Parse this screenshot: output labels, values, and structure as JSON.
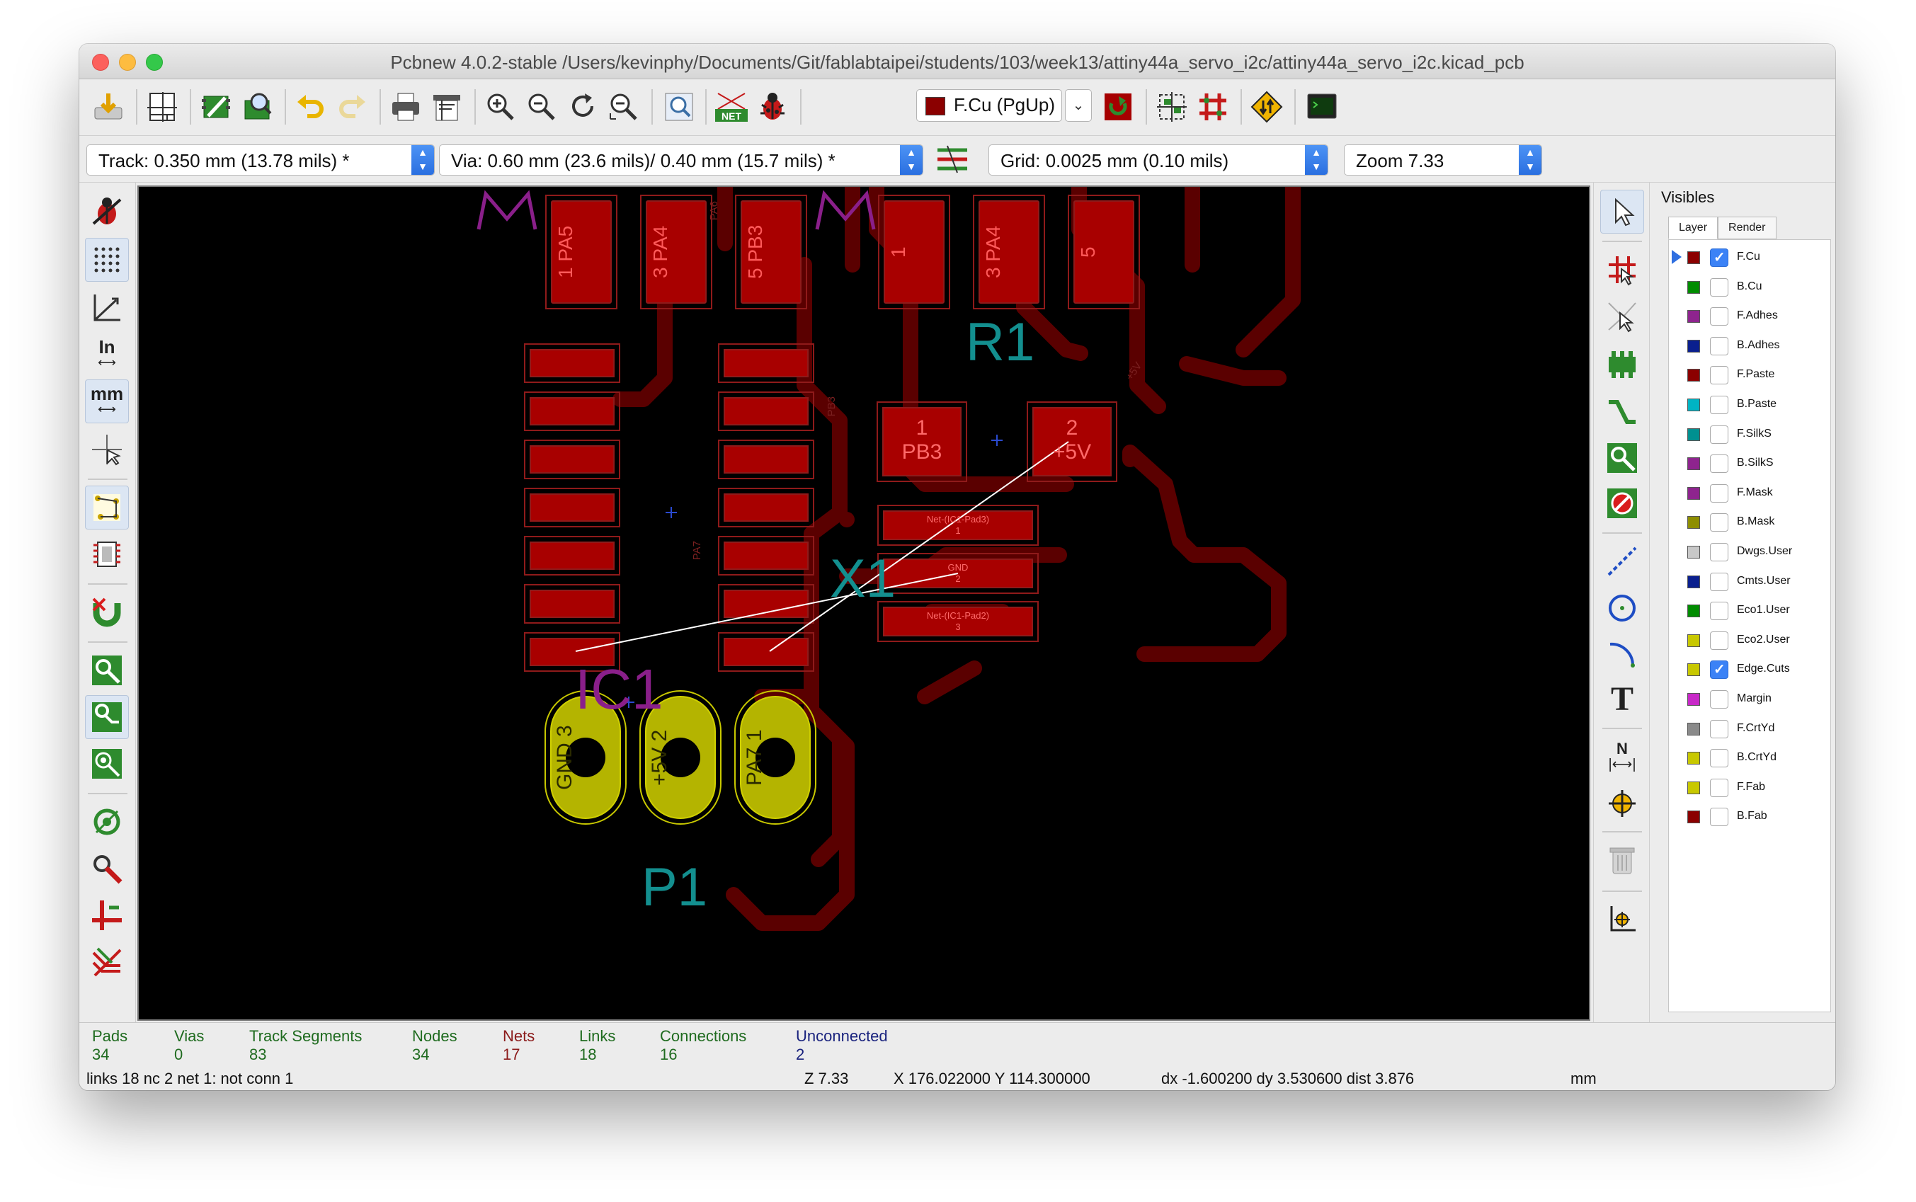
{
  "window": {
    "title": "Pcbnew 4.0.2-stable /Users/kevinphy/Documents/Git/fablabtaipei/students/103/week13/attiny44a_servo_i2c/attiny44a_servo_i2c.kicad_pcb"
  },
  "toolbar": {
    "layer_selector": "F.Cu (PgUp)",
    "icons": [
      "save-icon",
      "page-settings-icon",
      "library-editor-icon",
      "library-browser-icon",
      "undo-icon",
      "redo-icon",
      "print-icon",
      "plot-icon",
      "zoom-in-icon",
      "zoom-out-icon",
      "redraw-icon",
      "zoom-fit-icon",
      "find-icon",
      "netlist-icon",
      "drc-icon",
      "layer-select-icon",
      "layer-pair-icon",
      "autoplace-icon",
      "autoroute-icon",
      "microwave-icon",
      "scripting-console-icon"
    ]
  },
  "aux_toolbar": {
    "track": "Track: 0.350 mm (13.78 mils) *",
    "via": "Via: 0.60 mm (23.6 mils)/ 0.40 mm (15.7 mils) *",
    "grid": "Grid: 0.0025 mm (0.10 mils)",
    "zoom": "Zoom 7.33"
  },
  "left_toolbar": {
    "in_label": "In",
    "mm_label": "mm",
    "icons": [
      "drc-off-icon",
      "grid-toggle-icon",
      "polar-coords-icon",
      "inch-units-icon",
      "mm-units-icon",
      "cursor-shape-icon",
      "ratsnest-icon",
      "module-ratsnest-icon",
      "magnetic-icon",
      "zone-fill-icon",
      "track-sketch-icon",
      "via-sketch-icon",
      "high-contrast-icon",
      "microwave-tools-icon",
      "layer-manager-icon",
      "track-length-icon"
    ]
  },
  "right_toolbar": {
    "text_tool_label": "T",
    "dimension_label": "N",
    "icons": [
      "select-icon",
      "highlight-net-icon",
      "local-ratsnest-icon",
      "add-footprint-icon",
      "route-track-icon",
      "add-zone-icon",
      "keepout-icon",
      "add-line-icon",
      "add-circle-icon",
      "add-arc-icon",
      "add-text-icon",
      "add-dimension-icon",
      "target-icon",
      "delete-icon",
      "grid-origin-icon"
    ]
  },
  "pcb": {
    "labels": {
      "r1": "R1",
      "x1": "X1",
      "ic1": "IC1",
      "p1": "P1"
    },
    "top_pads": [
      {
        "num": "1",
        "net": "PA5"
      },
      {
        "num": "3",
        "net": "PA4"
      },
      {
        "num": "5",
        "net": "PB3"
      },
      {
        "num": "1",
        "net": ""
      },
      {
        "num": "3",
        "net": "PA4"
      },
      {
        "num": "5",
        "net": ""
      }
    ],
    "r1_pads": [
      {
        "num": "1",
        "net": "PB3"
      },
      {
        "num": "2",
        "net": "+5V"
      }
    ],
    "x1_pads": [
      {
        "net": "Net-(IC1-Pad3)",
        "num": "1"
      },
      {
        "net": "GND",
        "num": "2"
      },
      {
        "net": "Net-(IC1-Pad2)",
        "num": "3"
      }
    ],
    "p1_pads": [
      {
        "net": "GND",
        "num": "3"
      },
      {
        "net": "+5V",
        "num": "2"
      },
      {
        "net": "PA7",
        "num": "1"
      }
    ],
    "trace_labels": [
      "PA6",
      "PB3",
      "PA7",
      "+5V"
    ],
    "colors": {
      "fcu_pad": "#a80000",
      "fcu_track": "#5a0000",
      "fab": "#9e1f1f",
      "silk_teal": "#138f8f",
      "silk_purple": "#8a1f8a",
      "tht_pad": "#b4b400",
      "ratsnest": "#ffffff"
    }
  },
  "visibles": {
    "title": "Visibles",
    "tabs": [
      "Layer",
      "Render"
    ],
    "layers": [
      {
        "name": "F.Cu",
        "color": "#8b0000",
        "checked": true,
        "active": true
      },
      {
        "name": "B.Cu",
        "color": "#008c00",
        "checked": false
      },
      {
        "name": "F.Adhes",
        "color": "#8e248e",
        "checked": false
      },
      {
        "name": "B.Adhes",
        "color": "#0a1f8e",
        "checked": false
      },
      {
        "name": "F.Paste",
        "color": "#8b0000",
        "checked": false
      },
      {
        "name": "B.Paste",
        "color": "#00b4c4",
        "checked": false
      },
      {
        "name": "F.SilkS",
        "color": "#009090",
        "checked": false
      },
      {
        "name": "B.SilkS",
        "color": "#8e248e",
        "checked": false
      },
      {
        "name": "F.Mask",
        "color": "#8e248e",
        "checked": false
      },
      {
        "name": "B.Mask",
        "color": "#8e8e00",
        "checked": false
      },
      {
        "name": "Dwgs.User",
        "color": "#c8c8c8",
        "checked": false
      },
      {
        "name": "Cmts.User",
        "color": "#0a1f8e",
        "checked": false
      },
      {
        "name": "Eco1.User",
        "color": "#008c00",
        "checked": false
      },
      {
        "name": "Eco2.User",
        "color": "#c8c800",
        "checked": false
      },
      {
        "name": "Edge.Cuts",
        "color": "#c8c800",
        "checked": true
      },
      {
        "name": "Margin",
        "color": "#c828c8",
        "checked": false
      },
      {
        "name": "F.CrtYd",
        "color": "#8a8a8a",
        "checked": false
      },
      {
        "name": "B.CrtYd",
        "color": "#c8c800",
        "checked": false
      },
      {
        "name": "F.Fab",
        "color": "#c8c800",
        "checked": false
      },
      {
        "name": "B.Fab",
        "color": "#8b0000",
        "checked": false
      }
    ]
  },
  "status": {
    "stats": [
      {
        "label": "Pads",
        "value": "34",
        "color": "#1f6b1f"
      },
      {
        "label": "Vias",
        "value": "0",
        "color": "#1f6b1f"
      },
      {
        "label": "Track Segments",
        "value": "83",
        "color": "#1f6b1f"
      },
      {
        "label": "Nodes",
        "value": "34",
        "color": "#1f6b1f"
      },
      {
        "label": "Nets",
        "value": "17",
        "color": "#8b1a1a"
      },
      {
        "label": "Links",
        "value": "18",
        "color": "#1f6b1f"
      },
      {
        "label": "Connections",
        "value": "16",
        "color": "#1f6b1f"
      },
      {
        "label": "Unconnected",
        "value": "2",
        "color": "#1a237e"
      }
    ],
    "message": "links 18 nc 2  net 1: not conn 1",
    "zoom": "Z 7.33",
    "coords": "X 176.022000  Y 114.300000",
    "delta": "dx -1.600200  dy 3.530600  dist 3.876",
    "units": "mm"
  }
}
